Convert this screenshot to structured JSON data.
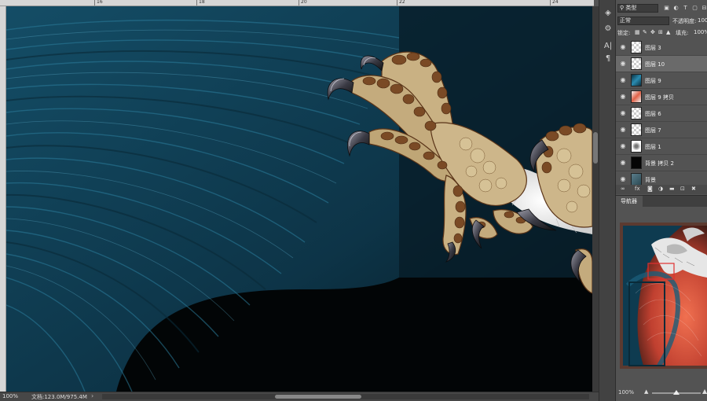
{
  "ruler": {
    "numbers": [
      "16",
      "18",
      "20",
      "22",
      "24"
    ]
  },
  "status": {
    "zoom": "100%",
    "doc_info": "文档:123.0M/975.4M",
    "arrow": "›"
  },
  "tools": [
    {
      "name": "layers-tool-icon",
      "glyph": "◈"
    },
    {
      "name": "adjust-tool-icon",
      "glyph": "⚙"
    },
    {
      "name": "character-tool-icon",
      "glyph": "A|"
    },
    {
      "name": "paragraph-tool-icon",
      "glyph": "¶"
    }
  ],
  "layers_panel": {
    "filter_kind": "类型",
    "blend_mode": "正常",
    "opacity_label": "不透明度:",
    "opacity_value": "100%",
    "lock_label": "锁定:",
    "fill_label": "填充:",
    "fill_value": "100%",
    "layers": [
      {
        "name": "图层 3",
        "thumb": "checker",
        "selected": false
      },
      {
        "name": "图层 10",
        "thumb": "checker",
        "selected": true
      },
      {
        "name": "图层 9",
        "thumb": "#1e6b84",
        "selected": false
      },
      {
        "name": "图层 9 拷贝",
        "thumb": "#d9624a",
        "selected": false
      },
      {
        "name": "图层 6",
        "thumb": "checker",
        "selected": false
      },
      {
        "name": "图层 7",
        "thumb": "checker",
        "selected": false
      },
      {
        "name": "图层 1",
        "thumb": "#3a3a3a",
        "selected": false
      },
      {
        "name": "背景 拷贝 2",
        "thumb": "#0a0a0a",
        "selected": false
      },
      {
        "name": "背景",
        "thumb": "#2c4a55",
        "selected": false
      }
    ],
    "footer": {
      "fx": "fx"
    }
  },
  "navigator": {
    "tab_label": "导航器",
    "zoom": "100%"
  },
  "colors": {
    "teal": "#0f3d52",
    "claw_tan": "#c8b184",
    "claw_brown": "#7a4a25",
    "talon": "#2a2a30",
    "accent_red": "#d04a3a"
  }
}
